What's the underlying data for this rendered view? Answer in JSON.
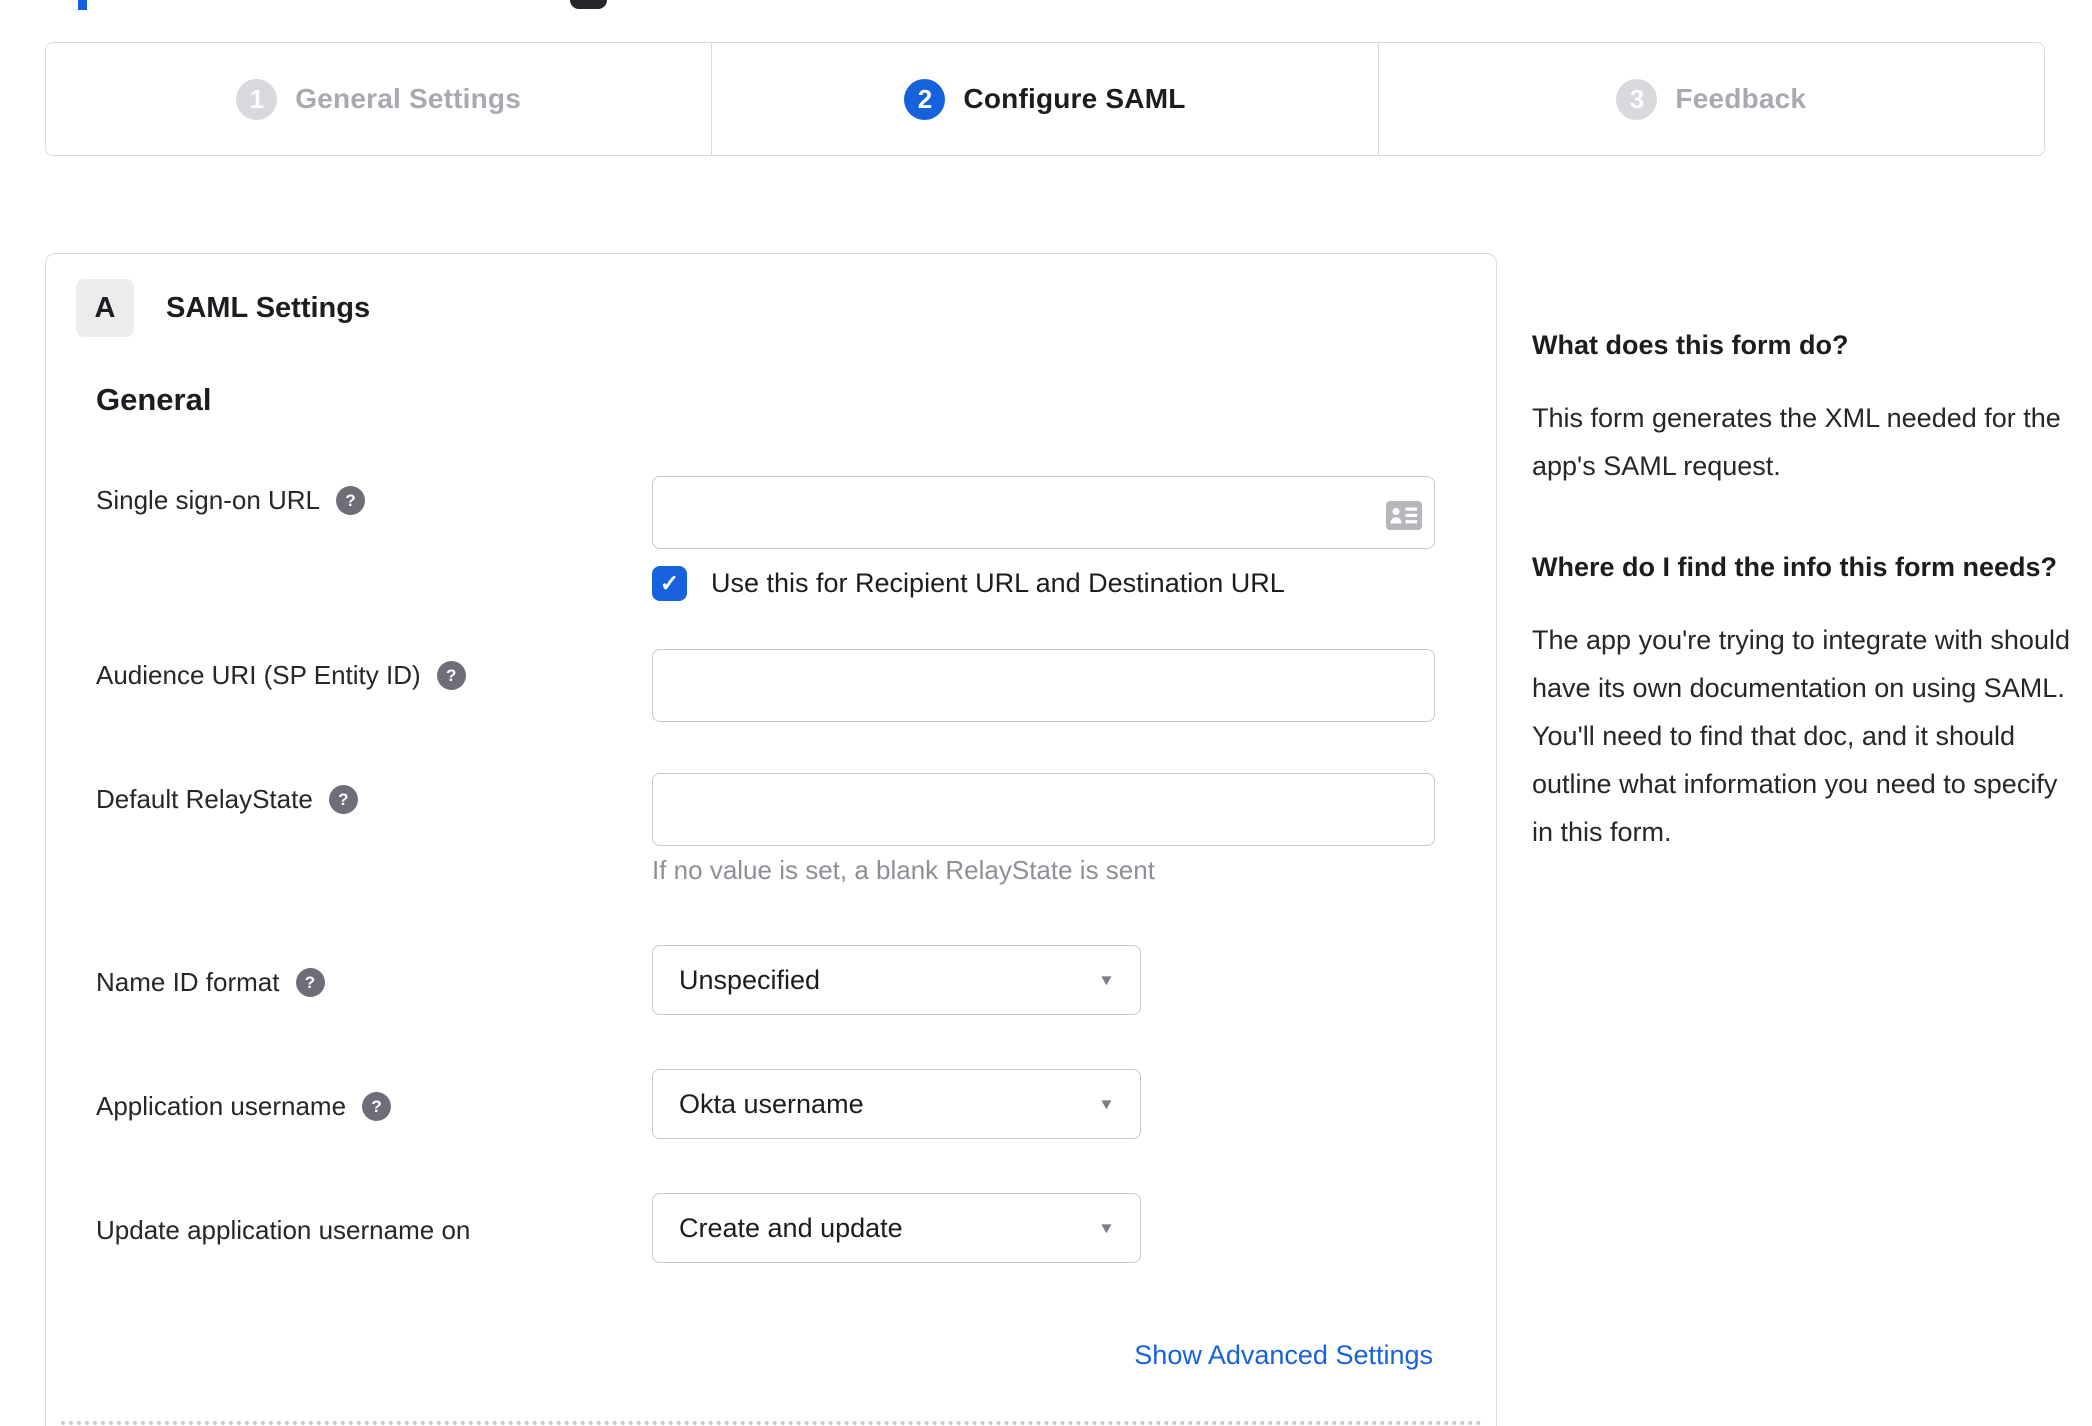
{
  "colors": {
    "accent_blue": "#1662dd",
    "dark_text": "#1d1d21",
    "inactive_step_text": "#a9a9b1",
    "inactive_step_circle": "#d8d8dd",
    "muted_hint_text": "#8f8f97",
    "border_gray": "#d9d9de"
  },
  "icons": {
    "help_glyph": "?",
    "caret_glyph": "▼",
    "check_glyph": "✓",
    "contact_card": "contact-card"
  },
  "stepper": {
    "steps": [
      {
        "number": "1",
        "label": "General Settings",
        "active": false
      },
      {
        "number": "2",
        "label": "Configure SAML",
        "active": true
      },
      {
        "number": "3",
        "label": "Feedback",
        "active": false
      }
    ]
  },
  "panel": {
    "badge": "A",
    "title": "SAML Settings",
    "group": "General",
    "rows": {
      "sso": {
        "label": "Single sign-on URL",
        "value": ""
      },
      "sso_checkbox": {
        "checked": true,
        "label": "Use this for Recipient URL and Destination URL"
      },
      "audience": {
        "label": "Audience URI (SP Entity ID)",
        "value": ""
      },
      "relay": {
        "label": "Default RelayState",
        "value": "",
        "hint": "If no value is set, a blank RelayState is sent"
      },
      "nameid": {
        "label": "Name ID format",
        "value": "Unspecified"
      },
      "appuser": {
        "label": "Application username",
        "value": "Okta username"
      },
      "updateuser": {
        "label": "Update application username on",
        "value": "Create and update"
      }
    },
    "advanced_link": "Show Advanced Settings"
  },
  "sidebar": {
    "sections": [
      {
        "heading": "What does this form do?",
        "body": "This form generates the XML needed for the app's SAML request."
      },
      {
        "heading": "Where do I find the info this form needs?",
        "body": "The app you're trying to integrate with should have its own documentation on using SAML. You'll need to find that doc, and it should outline what information you need to specify in this form."
      }
    ]
  }
}
